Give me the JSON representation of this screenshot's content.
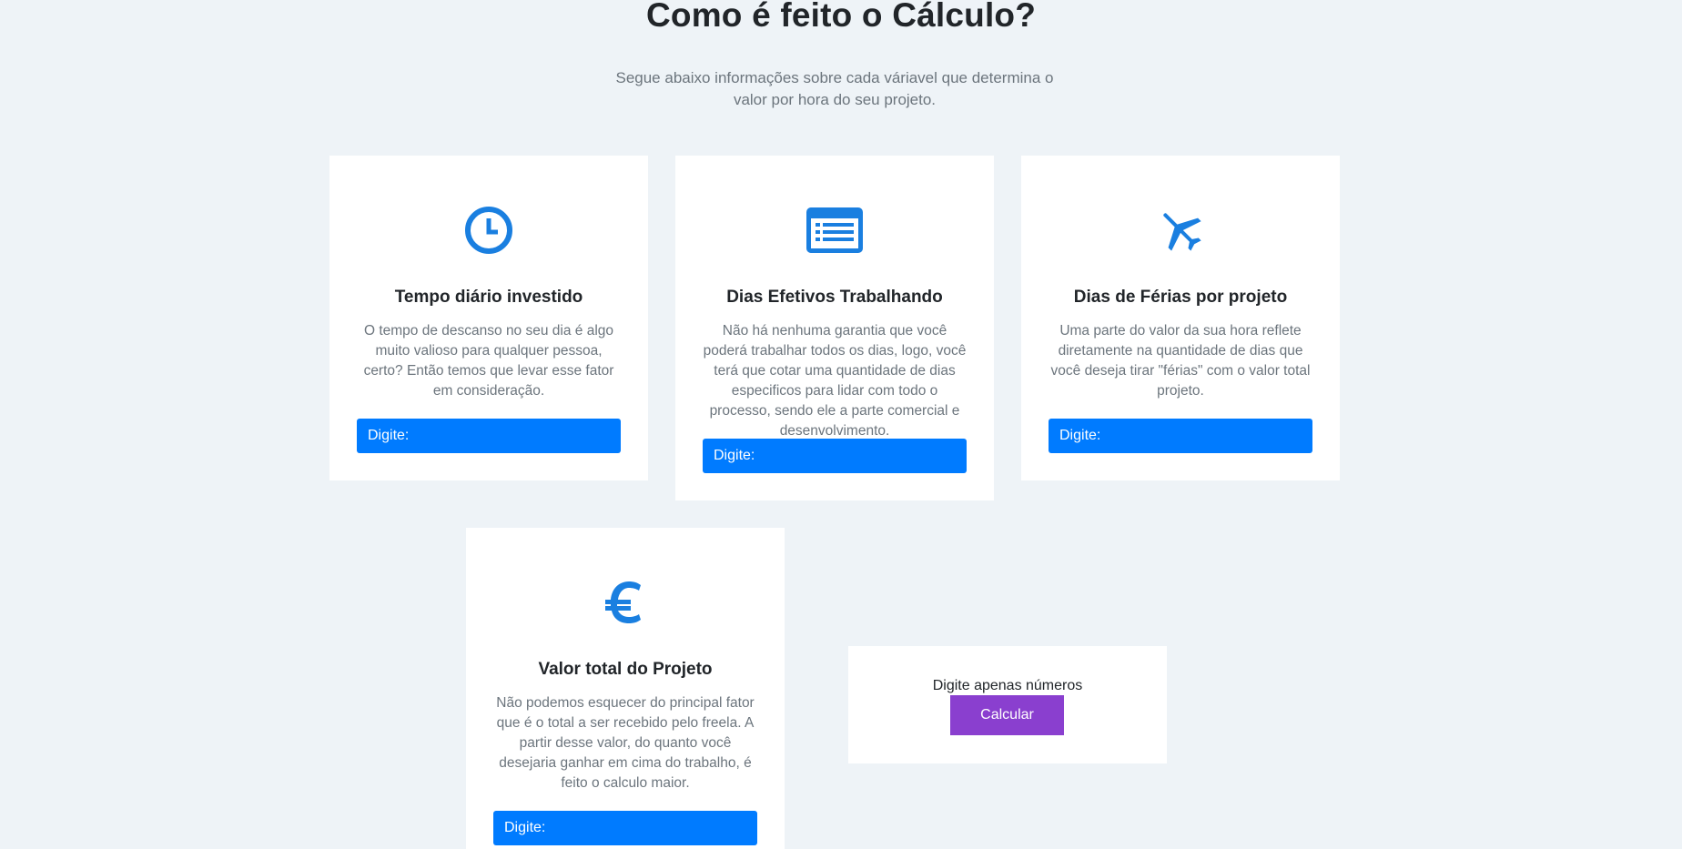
{
  "section": {
    "title": "Como é feito o Cálculo?",
    "subtitle": "Segue abaixo informações sobre cada váriavel que determina o valor por hora do seu projeto."
  },
  "cards": [
    {
      "icon": "clock-icon",
      "title": "Tempo diário investido",
      "text": "O tempo de descanso no seu dia é algo muito valioso para qualquer pessoa, certo? Então temos que levar esse fator em consideração.",
      "input_placeholder": "Digite:"
    },
    {
      "icon": "list-icon",
      "title": "Dias Efetivos Trabalhando",
      "text": "Não há nenhuma garantia que você poderá trabalhar todos os dias, logo, você terá que cotar uma quantidade de dias especificos para lidar com todo o processo, sendo ele a parte comercial e desenvolvimento.",
      "input_placeholder": "Digite:"
    },
    {
      "icon": "plane-icon",
      "title": "Dias de Férias por projeto",
      "text": "Uma parte do valor da sua hora reflete diretamente na quantidade de dias que você deseja tirar \"férias\" com o valor total projeto.",
      "input_placeholder": "Digite:"
    },
    {
      "icon": "euro-icon",
      "title": "Valor total do Projeto",
      "text": "Não podemos esquecer do principal fator que é o total a ser recebido pelo freela. A partir desse valor, do quanto você desejaria ganhar em cima do trabalho, é feito o calculo maior.",
      "input_placeholder": "Digite:"
    }
  ],
  "calculator": {
    "hint": "Digite apenas números",
    "button_label": "Calcular"
  },
  "colors": {
    "accent_blue": "#007bff",
    "icon_blue": "#1a7fe0",
    "button_purple": "#8a3fcf",
    "background": "#eef3f7"
  }
}
